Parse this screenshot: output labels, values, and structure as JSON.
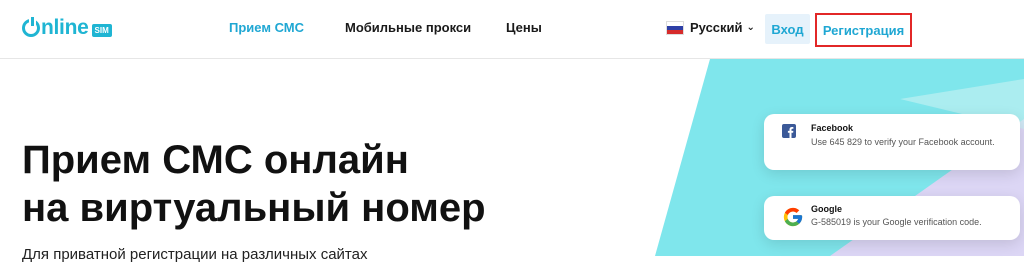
{
  "header": {
    "logo": {
      "text": "nline",
      "badge": "SIM"
    },
    "nav": [
      {
        "label": "Прием СМС",
        "active": true
      },
      {
        "label": "Мобильные прокси",
        "active": false
      },
      {
        "label": "Цены",
        "active": false
      }
    ],
    "language": {
      "label": "Русский",
      "flag_colors": [
        "#ffffff",
        "#2d3fa6",
        "#d62b2b"
      ]
    },
    "login_label": "Вход",
    "register_label": "Регистрация"
  },
  "hero": {
    "title_line1": "Прием СМС онлайн",
    "title_line2": "на виртуальный номер",
    "subtitle": "Для приватной регистрации на различных сайтах"
  },
  "cards": [
    {
      "icon": "facebook-icon",
      "title": "Facebook",
      "text": "Use 645 829 to verify your Facebook account."
    },
    {
      "icon": "google-icon",
      "title": "Google",
      "text": "G-585019 is your Google verification code."
    }
  ],
  "colors": {
    "accent": "#1fa7d3",
    "highlight": "#e22727",
    "cyan_bg": "#7fe6ec",
    "lavender_bg": "#dcd6f5"
  }
}
